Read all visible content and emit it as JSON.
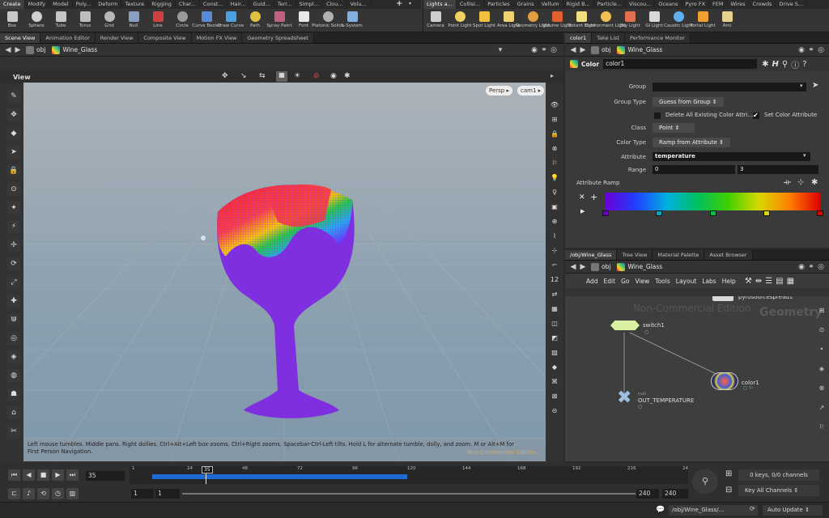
{
  "shelf": {
    "left_tabs": [
      "Create",
      "Modify",
      "Model",
      "Poly...",
      "Deform",
      "Texture",
      "Rigging",
      "Char...",
      "Const...",
      "Hair...",
      "Guid...",
      "Terr...",
      "Simpl...",
      "Clou...",
      "Volu..."
    ],
    "left_tools": [
      {
        "label": "Box",
        "icon": "box-icon",
        "color": "#c9c9c9"
      },
      {
        "label": "Sphere",
        "icon": "sphere-icon",
        "color": "#d0d0d0"
      },
      {
        "label": "Tube",
        "icon": "tube-icon",
        "color": "#c5c5c5"
      },
      {
        "label": "Torus",
        "icon": "torus-icon",
        "color": "#bdbdbd"
      },
      {
        "label": "Grid",
        "icon": "grid-icon",
        "color": "#b8b8b8"
      },
      {
        "label": "Null",
        "icon": "null-icon",
        "color": "#8aa0c0"
      },
      {
        "label": "Line",
        "icon": "line-icon",
        "color": "#d04040"
      },
      {
        "label": "Circle",
        "icon": "circle-icon",
        "color": "#9a9a9a"
      },
      {
        "label": "Curve Bezier",
        "icon": "curve-bezier-icon",
        "color": "#5b8ad6"
      },
      {
        "label": "Draw Curve",
        "icon": "draw-curve-icon",
        "color": "#4aa0e0"
      },
      {
        "label": "Path",
        "icon": "path-icon",
        "color": "#e0c040"
      },
      {
        "label": "Spray Paint",
        "icon": "spray-paint-icon",
        "color": "#c06080"
      },
      {
        "label": "Font",
        "icon": "font-icon",
        "color": "#e8e8e8"
      },
      {
        "label": "Platonic Solids",
        "icon": "platonic-solids-icon",
        "color": "#b0b0b0"
      },
      {
        "label": "L-System",
        "icon": "l-system-icon",
        "color": "#7fb0e0"
      }
    ],
    "right_tabs": [
      "Lights a...",
      "Collisi...",
      "Particles",
      "Grains",
      "Vellum",
      "Rigid B...",
      "Particle...",
      "Viscou...",
      "Oceans",
      "Pyro FX",
      "FEM",
      "Wires",
      "Crowds",
      "Drive S..."
    ],
    "right_tools": [
      {
        "label": "Camera",
        "icon": "camera-icon",
        "color": "#cfcfcf"
      },
      {
        "label": "Point Light",
        "icon": "point-light-icon",
        "color": "#f0d060"
      },
      {
        "label": "Spot Light",
        "icon": "spot-light-icon",
        "color": "#f0c040"
      },
      {
        "label": "Area Light",
        "icon": "area-light-icon",
        "color": "#f0d070"
      },
      {
        "label": "Geometry Light",
        "icon": "geometry-light-icon",
        "color": "#e0a040"
      },
      {
        "label": "Volume Light",
        "icon": "volume-light-icon",
        "color": "#e06030"
      },
      {
        "label": "Distant Light",
        "icon": "distant-light-icon",
        "color": "#f0e080"
      },
      {
        "label": "Environment Light",
        "icon": "environment-light-icon",
        "color": "#f0c050"
      },
      {
        "label": "Sky Light",
        "icon": "sky-light-icon",
        "color": "#e07050"
      },
      {
        "label": "GI Light",
        "icon": "gi-light-icon",
        "color": "#d8d8d8"
      },
      {
        "label": "Caustic Light",
        "icon": "caustic-light-icon",
        "color": "#60b0f0"
      },
      {
        "label": "Portal Light",
        "icon": "portal-light-icon",
        "color": "#f0a030"
      },
      {
        "label": "Ami",
        "icon": "ambient-light-icon",
        "color": "#e8d090"
      }
    ]
  },
  "scene": {
    "tabs": [
      "Scene View",
      "Animation Editor",
      "Render View",
      "Composite View",
      "Motion FX View",
      "Geometry Spreadsheet"
    ],
    "path": [
      "obj",
      "Wine_Glass"
    ],
    "view_label": "View",
    "persp": "Persp",
    "cam": "cam1",
    "help_text": "Left mouse tumbles. Middle pans. Right dollies. Ctrl+Alt+Left box-zooms. Ctrl+Right zooms. Spacebar-Ctrl-Left tilts. Hold L for alternate tumble, dolly, and zoom.     M or Alt+M for First Person Navigation.",
    "watermark": "Non-Commercial Edition"
  },
  "params": {
    "tabs": [
      "color1",
      "Take List",
      "Performance Monitor"
    ],
    "path": [
      "obj",
      "Wine_Glass"
    ],
    "node_type": "Color",
    "node_name": "color1",
    "group_label": "Group",
    "group_value": "",
    "group_type_label": "Group Type",
    "group_type_value": "Guess from Group",
    "delete_label": "Delete All Existing Color Attri...",
    "set_color_label": "Set Color Attribute",
    "class_label": "Class",
    "class_value": "Point",
    "color_type_label": "Color Type",
    "color_type_value": "Ramp from Attribute",
    "attribute_label": "Attribute",
    "attribute_value": "temperature",
    "range_label": "Range",
    "range_min": "0",
    "range_max": "3",
    "ramp_label": "Attribute Ramp",
    "ramp_keys": [
      {
        "pos": 0.0,
        "color": "#6a00c8"
      },
      {
        "pos": 0.25,
        "color": "#00a8c0"
      },
      {
        "pos": 0.5,
        "color": "#00c040"
      },
      {
        "pos": 0.75,
        "color": "#d8d800"
      },
      {
        "pos": 1.0,
        "color": "#e00000"
      }
    ]
  },
  "network": {
    "tabs": [
      "/obj/Wine_Glass",
      "Tree View",
      "Material Palette",
      "Asset Browser"
    ],
    "path": [
      "obj",
      "Wine_Glass"
    ],
    "menu": [
      "Add",
      "Edit",
      "Go",
      "View",
      "Tools",
      "Layout",
      "Labs",
      "Help"
    ],
    "watermark": "Non-Commercial Edition",
    "context_label": "Geometry",
    "nodes": [
      {
        "name": "pyrosourcespread1",
        "sub": ""
      },
      {
        "name": "switch1",
        "sub": ""
      },
      {
        "name": "color1",
        "sub": ""
      },
      {
        "name": "OUT_TEMPERATURE",
        "sub": "null"
      }
    ]
  },
  "timeline": {
    "current_frame": "35",
    "ticks": [
      "1",
      "24",
      "48",
      "72",
      "96",
      "120",
      "144",
      "168",
      "192",
      "216",
      "24"
    ],
    "start_frame": "1",
    "start_frame2": "1",
    "end_frame": "240",
    "end_frame2": "240",
    "keys_info": "0 keys, 0/0 channels",
    "key_all": "Key All Channels",
    "status_path": "/obj/Wine_Glass/...",
    "auto_update": "Auto Update"
  }
}
